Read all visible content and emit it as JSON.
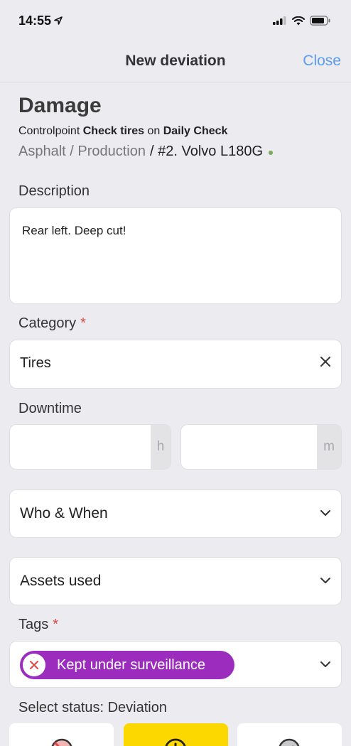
{
  "status_bar": {
    "time": "14:55"
  },
  "nav": {
    "title": "New deviation",
    "close_label": "Close"
  },
  "header": {
    "title": "Damage",
    "controlpoint_prefix": "Controlpoint",
    "controlpoint_name": "Check tires",
    "on_word": "on",
    "check_name": "Daily Check",
    "path_grey": "Asphalt / Production",
    "path_dark": "/ #2. Volvo L180G"
  },
  "description": {
    "label": "Description",
    "value": "Rear left. Deep cut!"
  },
  "category": {
    "label": "Category",
    "required_mark": "*",
    "value": "Tires"
  },
  "downtime": {
    "label": "Downtime",
    "hours_unit": "h",
    "minutes_unit": "m"
  },
  "who_when": {
    "label": "Who & When"
  },
  "assets_used": {
    "label": "Assets used"
  },
  "tags": {
    "label": "Tags",
    "required_mark": "*",
    "chip_label": "Kept under surveillance",
    "chip_color": "#9c2cbd"
  },
  "select_status": {
    "label": "Select status: Deviation",
    "selected_color": "#fcd800"
  },
  "colors": {
    "accent": "#5a9cf0",
    "required": "#e04545",
    "ok_dot": "#7ba85a",
    "background": "#ebebf0"
  }
}
